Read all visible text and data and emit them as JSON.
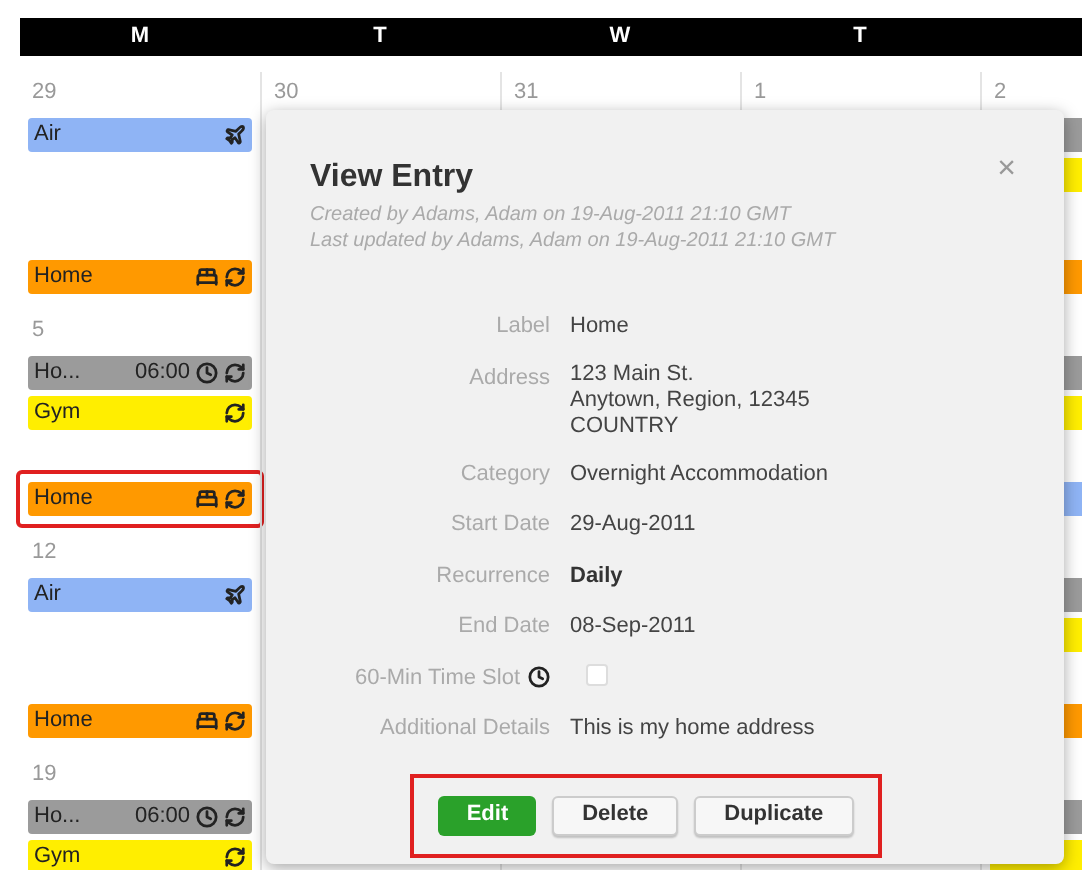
{
  "calendar": {
    "days": [
      {
        "label": "M"
      },
      {
        "label": "T"
      },
      {
        "label": "W"
      },
      {
        "label": "T"
      }
    ],
    "weeks": [
      {
        "cells": [
          {
            "date": "29",
            "events": [
              {
                "kind": "air",
                "label": "Air",
                "color": "#8fb4f5"
              }
            ],
            "late_events": [
              {
                "kind": "home",
                "label": "Home",
                "color": "#ff9900"
              }
            ]
          },
          {
            "date": "30"
          },
          {
            "date": "31"
          },
          {
            "date": "1"
          },
          {
            "date": "2",
            "events": [
              {
                "kind": "bar",
                "color": "#9b9b9b"
              },
              {
                "kind": "bar",
                "color": "#ffee00"
              }
            ],
            "late_events": [
              {
                "kind": "bar",
                "color": "#ff9900"
              }
            ]
          }
        ]
      },
      {
        "cells": [
          {
            "date": "5",
            "events": [
              {
                "kind": "timed",
                "label": "Ho...",
                "time": "06:00",
                "color": "#9b9b9b"
              },
              {
                "kind": "gym",
                "label": "Gym",
                "color": "#ffee00"
              }
            ],
            "late_events": [
              {
                "kind": "home",
                "label": "Home",
                "color": "#ff9900",
                "highlighted": true
              }
            ]
          },
          {},
          {},
          {},
          {
            "events": [
              {
                "kind": "bar",
                "color": "#9b9b9b"
              },
              {
                "kind": "bar",
                "color": "#ffee00"
              }
            ],
            "late_events": [
              {
                "kind": "bar",
                "color": "#8fb4f5"
              }
            ]
          }
        ]
      },
      {
        "cells": [
          {
            "date": "12",
            "events": [
              {
                "kind": "air",
                "label": "Air",
                "color": "#8fb4f5"
              }
            ],
            "late_events": [
              {
                "kind": "home",
                "label": "Home",
                "color": "#ff9900"
              }
            ]
          },
          {},
          {},
          {},
          {
            "events": [
              {
                "kind": "bar",
                "color": "#9b9b9b"
              },
              {
                "kind": "bar",
                "color": "#ffee00"
              }
            ],
            "late_events": [
              {
                "kind": "bar",
                "color": "#ff9900"
              }
            ]
          }
        ]
      },
      {
        "cells": [
          {
            "date": "19",
            "events": [
              {
                "kind": "timed",
                "label": "Ho...",
                "time": "06:00",
                "color": "#9b9b9b"
              },
              {
                "kind": "gym",
                "label": "Gym",
                "color": "#ffee00"
              }
            ]
          },
          {},
          {},
          {},
          {
            "events": [
              {
                "kind": "bar",
                "color": "#9b9b9b"
              },
              {
                "kind": "bar",
                "color": "#ffee00"
              }
            ]
          }
        ]
      }
    ]
  },
  "dialog": {
    "title": "View Entry",
    "created": "Created by Adams, Adam on 19-Aug-2011 21:10 GMT",
    "updated": "Last updated by Adams, Adam on 19-Aug-2011 21:10 GMT",
    "close": "×",
    "fields": [
      {
        "kind": "text",
        "label": "Label",
        "value": "Home"
      },
      {
        "kind": "address",
        "label": "Address",
        "lines": [
          "123 Main St.",
          "Anytown, Region, 12345",
          "COUNTRY"
        ]
      },
      {
        "kind": "text",
        "label": "Category",
        "value": "Overnight Accommodation"
      },
      {
        "kind": "text",
        "label": "Start Date",
        "value": "29-Aug-2011"
      },
      {
        "kind": "strong",
        "label": "Recurrence",
        "value": "Daily"
      },
      {
        "kind": "text",
        "label": "End Date",
        "value": "08-Sep-2011"
      },
      {
        "kind": "checkbox",
        "label": "60-Min Time Slot",
        "checked": false
      },
      {
        "kind": "text",
        "label": "Additional Details",
        "value": "This is my home address"
      }
    ],
    "buttons_highlighted": true,
    "buttons": [
      {
        "kind": "primary",
        "label": "Edit"
      },
      {
        "kind": "default",
        "label": "Delete"
      },
      {
        "kind": "default",
        "label": "Duplicate"
      }
    ]
  }
}
